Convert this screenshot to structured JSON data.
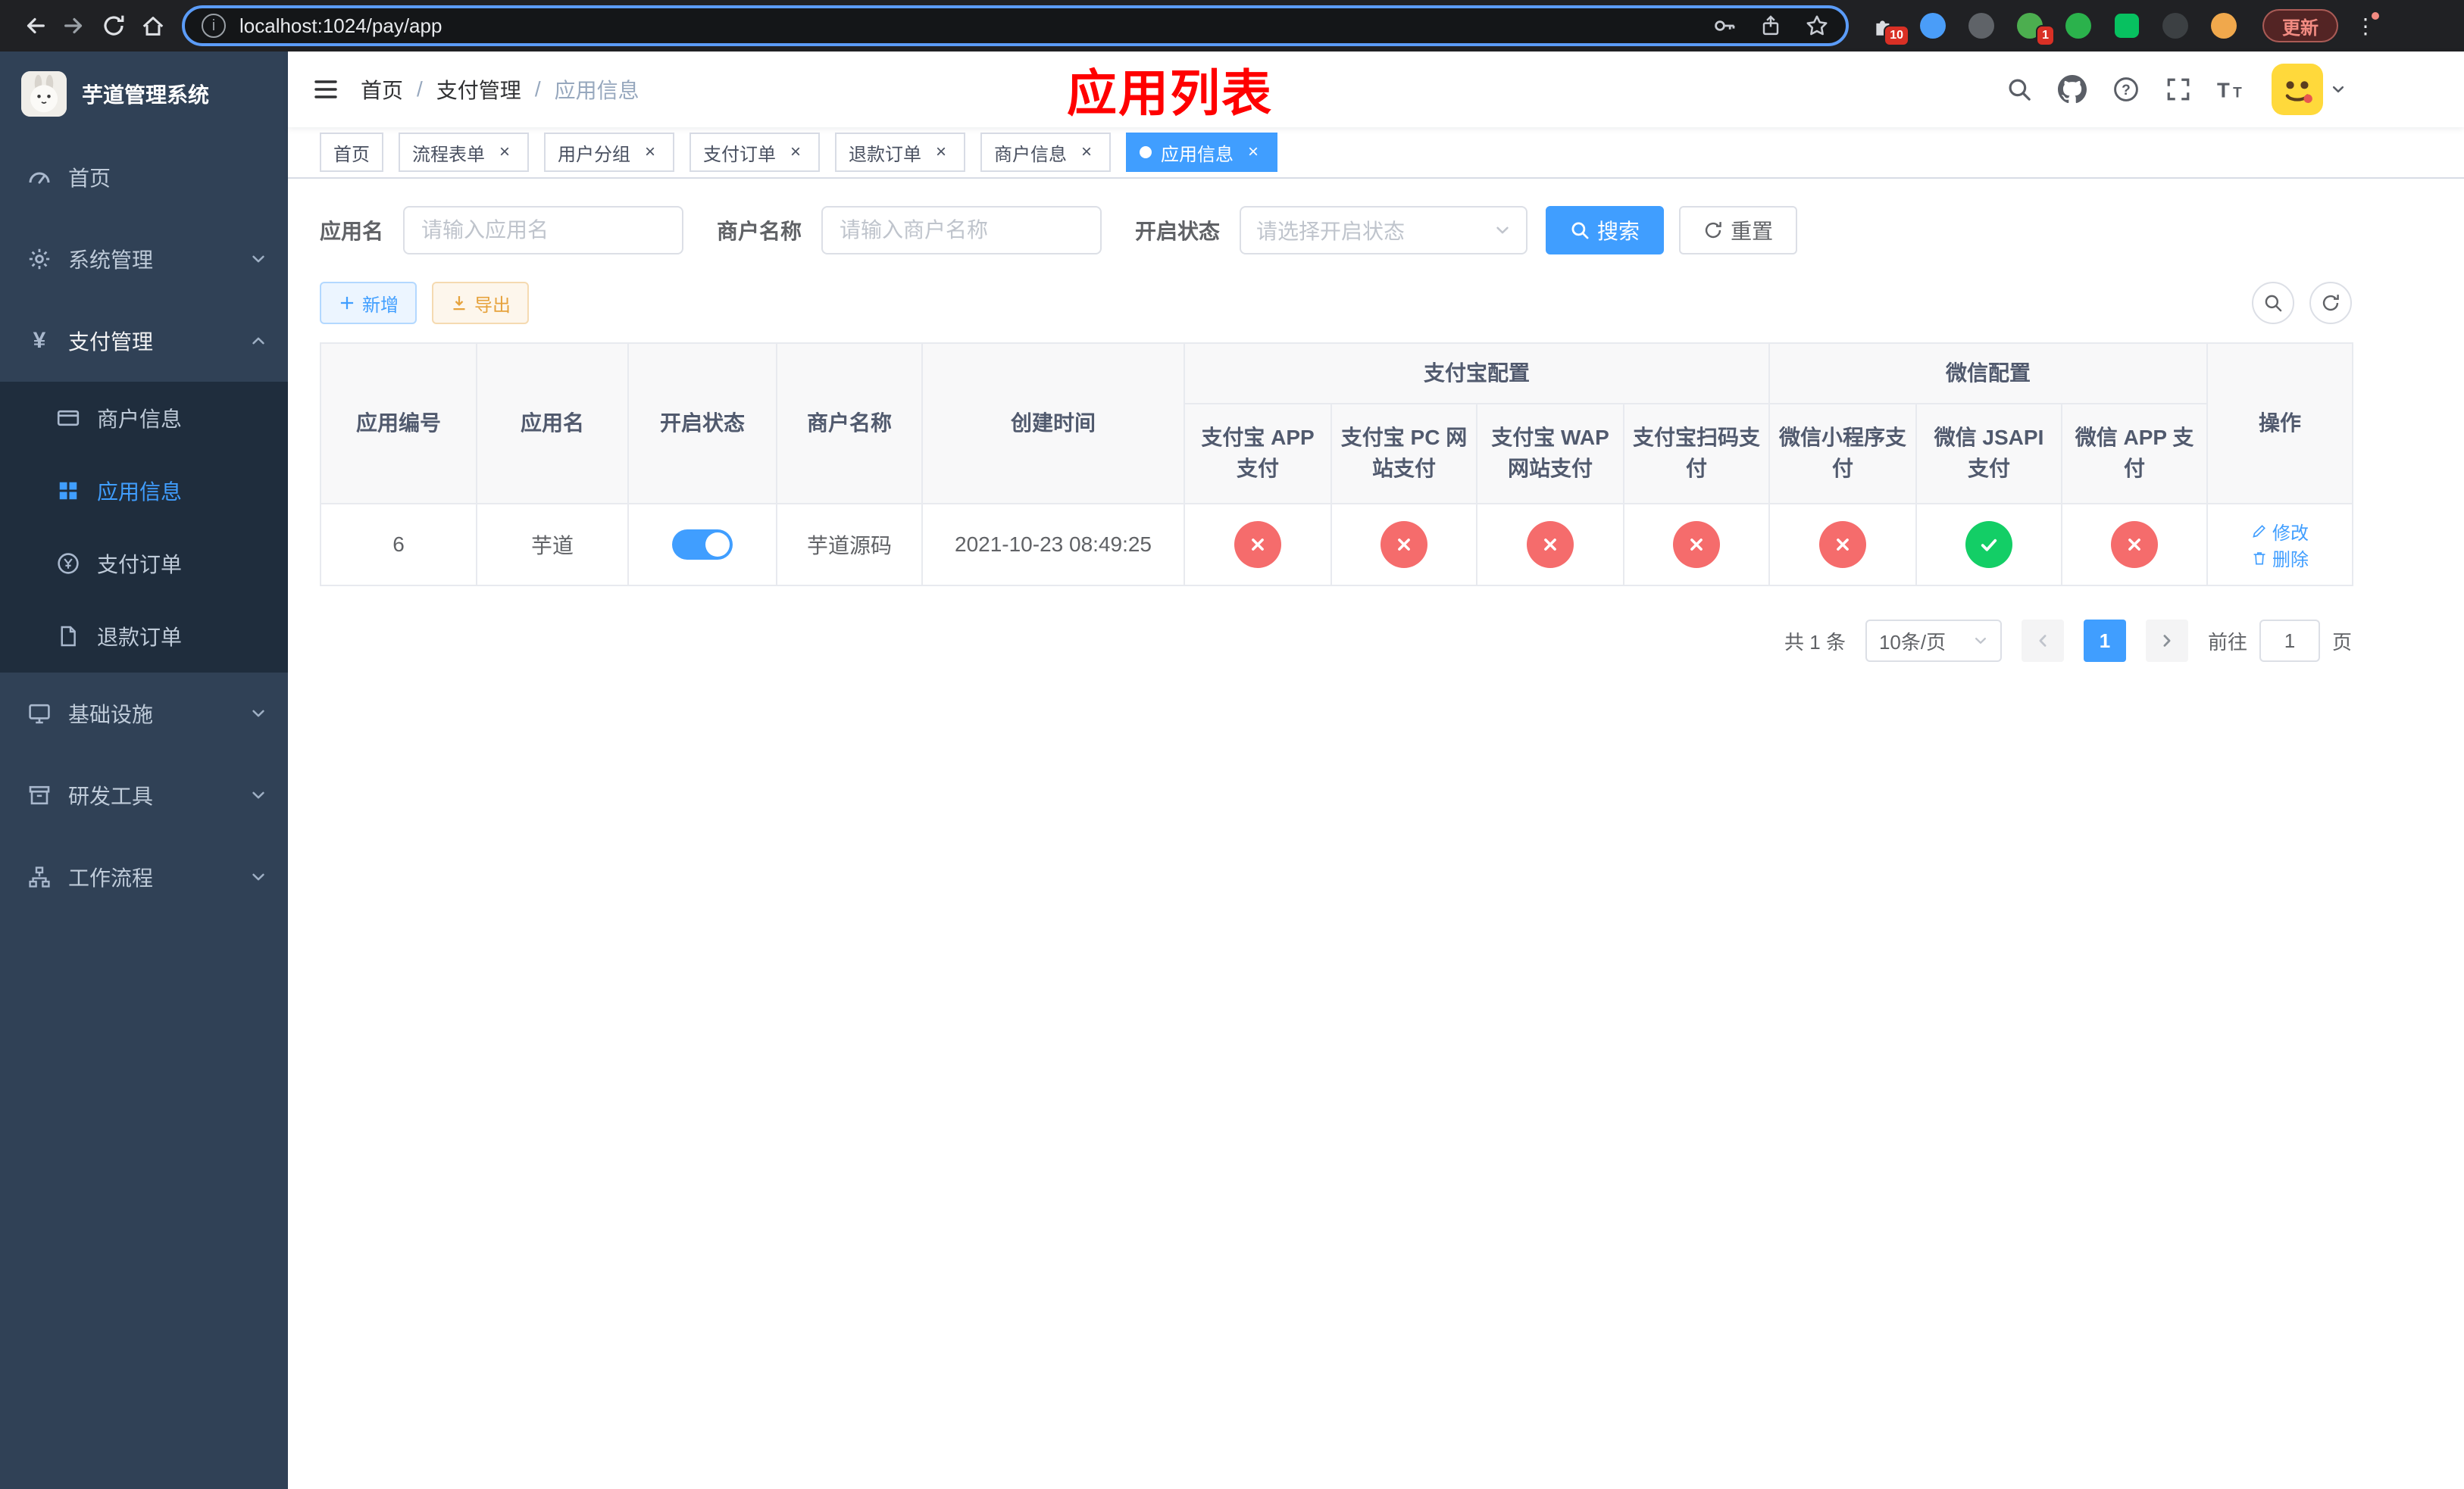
{
  "browser": {
    "url": "localhost:1024/pay/app",
    "update_label": "更新",
    "ext_badge_1": "10",
    "ext_badge_2": "1"
  },
  "colors": {
    "accent": "#409eff",
    "danger": "#f56c6c",
    "success": "#13ce66",
    "warning": "#e6a23c",
    "title_red": "#ff0000",
    "sidebar_bg": "#304156",
    "submenu_bg": "#1f2d3d"
  },
  "sidebar": {
    "logo_title": "芋道管理系统",
    "items": [
      {
        "label": "首页"
      },
      {
        "label": "系统管理"
      },
      {
        "label": "支付管理"
      },
      {
        "label": "基础设施"
      },
      {
        "label": "研发工具"
      },
      {
        "label": "工作流程"
      }
    ],
    "submenu": [
      {
        "label": "商户信息"
      },
      {
        "label": "应用信息"
      },
      {
        "label": "支付订单"
      },
      {
        "label": "退款订单"
      }
    ]
  },
  "header": {
    "breadcrumb": [
      {
        "label": "首页"
      },
      {
        "label": "支付管理"
      },
      {
        "label": "应用信息"
      }
    ],
    "page_title": "应用列表"
  },
  "tabs": [
    {
      "label": "首页"
    },
    {
      "label": "流程表单"
    },
    {
      "label": "用户分组"
    },
    {
      "label": "支付订单"
    },
    {
      "label": "退款订单"
    },
    {
      "label": "商户信息"
    },
    {
      "label": "应用信息"
    }
  ],
  "filters": {
    "app_name_label": "应用名",
    "app_name_placeholder": "请输入应用名",
    "merchant_label": "商户名称",
    "merchant_placeholder": "请输入商户名称",
    "status_label": "开启状态",
    "status_placeholder": "请选择开启状态",
    "search_label": "搜索",
    "reset_label": "重置"
  },
  "toolbar": {
    "add_label": "新增",
    "export_label": "导出"
  },
  "table": {
    "col_app_id": "应用编号",
    "col_app_name": "应用名",
    "col_status": "开启状态",
    "col_merchant": "商户名称",
    "col_created": "创建时间",
    "group_alipay": "支付宝配置",
    "group_wechat": "微信配置",
    "col_alipay_app": "支付宝 APP 支付",
    "col_alipay_pc": "支付宝 PC 网站支付",
    "col_alipay_wap": "支付宝 WAP 网站支付",
    "col_alipay_qr": "支付宝扫码支付",
    "col_wx_mini": "微信小程序支付",
    "col_wx_jsapi": "微信 JSAPI 支付",
    "col_wx_app": "微信 APP 支付",
    "col_actions": "操作",
    "row": {
      "id": "6",
      "name": "芋道",
      "status_on": true,
      "merchant": "芋道源码",
      "created": "2021-10-23 08:49:25",
      "configs": [
        "no",
        "no",
        "no",
        "no",
        "no",
        "yes",
        "no"
      ],
      "edit_label": "修改",
      "delete_label": "删除"
    }
  },
  "pagination": {
    "total_text": "共 1 条",
    "page_size_text": "10条/页",
    "page_1": "1",
    "goto_prefix": "前往",
    "goto_value": "1",
    "goto_suffix": "页"
  }
}
